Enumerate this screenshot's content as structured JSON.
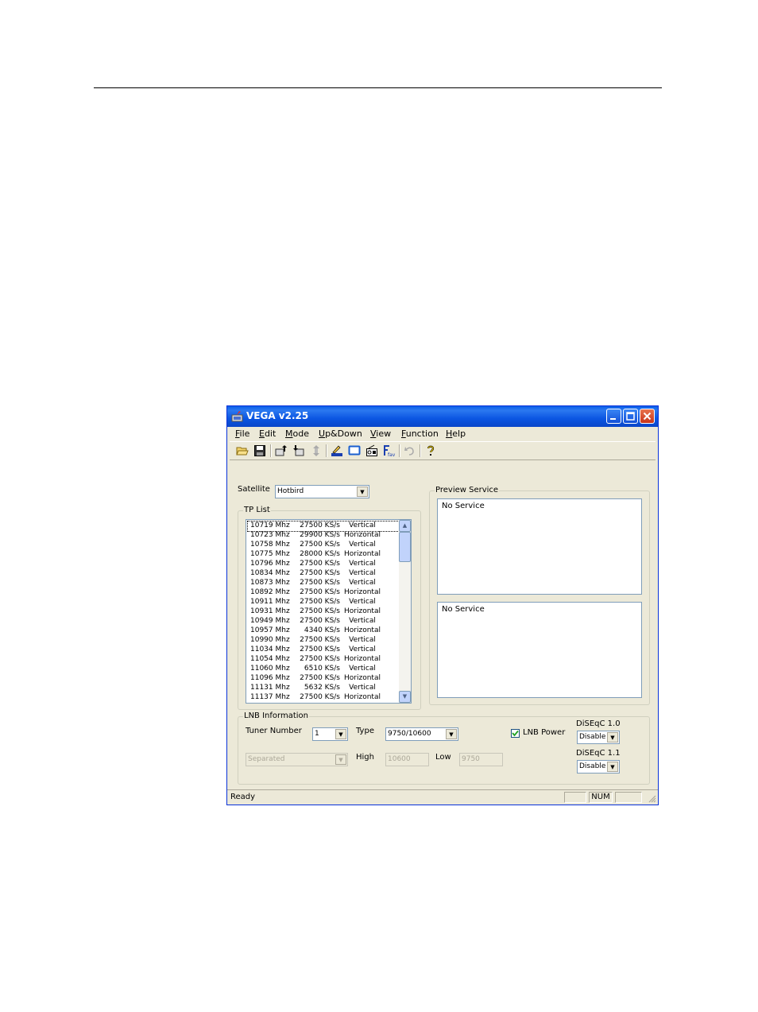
{
  "window": {
    "title": "VEGA v2.25"
  },
  "menu": [
    {
      "label": "File",
      "key": "F",
      "rest": "ile"
    },
    {
      "label": "Edit",
      "key": "E",
      "rest": "dit"
    },
    {
      "label": "Mode",
      "key": "M",
      "rest": "ode"
    },
    {
      "label": "Up&Down",
      "key": "U",
      "rest": "p&Down"
    },
    {
      "label": "View",
      "key": "V",
      "rest": "iew"
    },
    {
      "label": "Function",
      "key": "F",
      "rest": "unction"
    },
    {
      "label": "Help",
      "key": "H",
      "rest": "elp"
    }
  ],
  "toolbar": {
    "icons": [
      "open-folder-icon",
      "save-icon",
      "upload-icon",
      "download-icon",
      "transfer-icon",
      "edit-icon",
      "tv-icon",
      "radio-icon",
      "favorite-icon",
      "undo-icon",
      "help-icon"
    ],
    "fav_label": "fav"
  },
  "satellite": {
    "label": "Satellite",
    "value": "Hotbird"
  },
  "tp_list": {
    "label": "TP List",
    "rows": [
      {
        "freq": "10719 Mhz",
        "sr": "27500 KS/s",
        "pol": "Vertical"
      },
      {
        "freq": "10723 Mhz",
        "sr": "29900 KS/s",
        "pol": "Horizontal"
      },
      {
        "freq": "10758 Mhz",
        "sr": "27500 KS/s",
        "pol": "Vertical"
      },
      {
        "freq": "10775 Mhz",
        "sr": "28000 KS/s",
        "pol": "Horizontal"
      },
      {
        "freq": "10796 Mhz",
        "sr": "27500 KS/s",
        "pol": "Vertical"
      },
      {
        "freq": "10834 Mhz",
        "sr": "27500 KS/s",
        "pol": "Vertical"
      },
      {
        "freq": "10873 Mhz",
        "sr": "27500 KS/s",
        "pol": "Vertical"
      },
      {
        "freq": "10892 Mhz",
        "sr": "27500 KS/s",
        "pol": "Horizontal"
      },
      {
        "freq": "10911 Mhz",
        "sr": "27500 KS/s",
        "pol": "Vertical"
      },
      {
        "freq": "10931 Mhz",
        "sr": "27500 KS/s",
        "pol": "Horizontal"
      },
      {
        "freq": "10949 Mhz",
        "sr": "27500 KS/s",
        "pol": "Vertical"
      },
      {
        "freq": "10957 Mhz",
        "sr": "4340 KS/s",
        "pol": "Horizontal"
      },
      {
        "freq": "10990 Mhz",
        "sr": "27500 KS/s",
        "pol": "Vertical"
      },
      {
        "freq": "11034 Mhz",
        "sr": "27500 KS/s",
        "pol": "Vertical"
      },
      {
        "freq": "11054 Mhz",
        "sr": "27500 KS/s",
        "pol": "Horizontal"
      },
      {
        "freq": "11060 Mhz",
        "sr": "6510 KS/s",
        "pol": "Vertical"
      },
      {
        "freq": "11096 Mhz",
        "sr": "27500 KS/s",
        "pol": "Horizontal"
      },
      {
        "freq": "11131 Mhz",
        "sr": "5632 KS/s",
        "pol": "Vertical"
      },
      {
        "freq": "11137 Mhz",
        "sr": "27500 KS/s",
        "pol": "Horizontal"
      }
    ]
  },
  "preview": {
    "label": "Preview Service",
    "tv_text": "No Service",
    "radio_text": "No Service"
  },
  "lnb": {
    "label": "LNB Information",
    "tuner_label": "Tuner Number",
    "tuner_value": "1",
    "type_label": "Type",
    "type_value": "9750/10600",
    "power_label": "LNB Power",
    "power_checked": true,
    "mode_value": "Separated",
    "high_label": "High",
    "high_value": "10600",
    "low_label": "Low",
    "low_value": "9750",
    "diseqc10_label": "DiSEqC 1.0",
    "diseqc10_value": "Disable",
    "diseqc11_label": "DiSEqC 1.1",
    "diseqc11_value": "Disable"
  },
  "status": {
    "text": "Ready",
    "num": "NUM"
  },
  "colors": {
    "title_blue": "#0a5ee8",
    "face": "#ece9d8",
    "close_red": "#c8341a"
  }
}
